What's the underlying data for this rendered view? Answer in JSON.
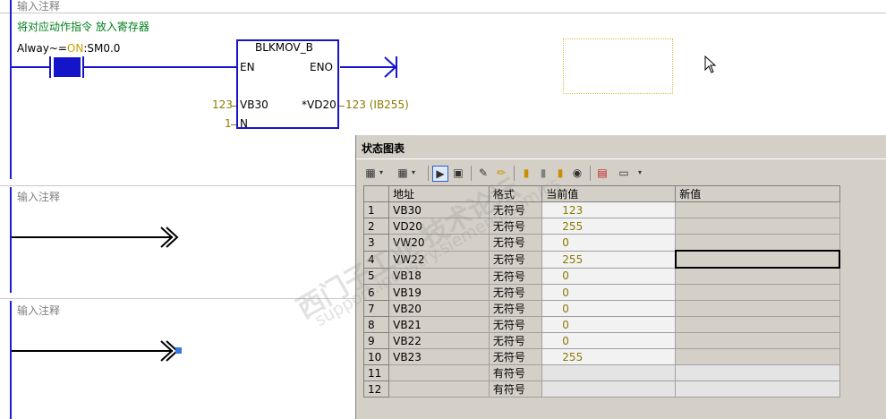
{
  "networks": [
    {
      "comment": "输入注释"
    },
    {
      "comment": "输入注释"
    },
    {
      "comment": "输入注释"
    }
  ],
  "network1": {
    "title_comment": "将对应动作指令 放入寄存器",
    "contact_label_prefix": "Alway~=",
    "contact_label_on": "ON",
    "contact_label_suffix": ":SM0.0",
    "block_name": "BLKMOV_B",
    "en": "EN",
    "eno": "ENO",
    "in_value": "123",
    "in_pin": "VB30",
    "out_pin": "*VD20",
    "out_value": "123 (IB255)",
    "n_value": "1",
    "n_pin": "N"
  },
  "status_chart": {
    "title": "状态图表",
    "columns": [
      "",
      "地址",
      "格式",
      "当前值",
      "新值"
    ],
    "rows": [
      {
        "n": "1",
        "addr": "VB30",
        "fmt": "无符号",
        "cur": "123",
        "new": ""
      },
      {
        "n": "2",
        "addr": "VD20",
        "fmt": "无符号",
        "cur": "255",
        "new": ""
      },
      {
        "n": "3",
        "addr": "VW20",
        "fmt": "无符号",
        "cur": "0",
        "new": ""
      },
      {
        "n": "4",
        "addr": "VW22",
        "fmt": "无符号",
        "cur": "255",
        "new": ""
      },
      {
        "n": "5",
        "addr": "VB18",
        "fmt": "无符号",
        "cur": "0",
        "new": ""
      },
      {
        "n": "6",
        "addr": "VB19",
        "fmt": "无符号",
        "cur": "0",
        "new": ""
      },
      {
        "n": "7",
        "addr": "VB20",
        "fmt": "无符号",
        "cur": "0",
        "new": ""
      },
      {
        "n": "8",
        "addr": "VB21",
        "fmt": "无符号",
        "cur": "0",
        "new": ""
      },
      {
        "n": "9",
        "addr": "VB22",
        "fmt": "无符号",
        "cur": "0",
        "new": ""
      },
      {
        "n": "10",
        "addr": "VB23",
        "fmt": "无符号",
        "cur": "255",
        "new": ""
      },
      {
        "n": "11",
        "addr": "",
        "fmt": "有符号",
        "cur": "",
        "new": ""
      },
      {
        "n": "12",
        "addr": "",
        "fmt": "有符号",
        "cur": "",
        "new": ""
      }
    ]
  },
  "watermark": {
    "line1": "西门子工业 技术论坛",
    "line2": "support.industry.siemens.com/cs"
  },
  "colors": {
    "wire": "#1414c8",
    "value": "#8a7a00",
    "comment_green": "#00801e",
    "on_text": "#c8a000"
  }
}
